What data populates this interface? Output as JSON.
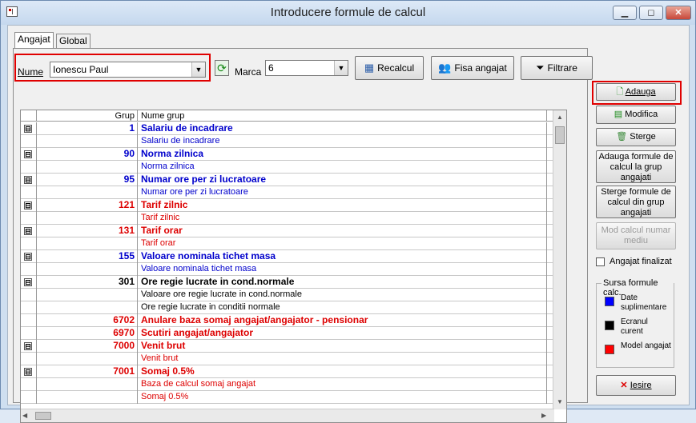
{
  "window": {
    "title": "Introducere formule de calcul",
    "minimize_label": "▭",
    "maximize_label": "◻",
    "close_label": "✕"
  },
  "tabs": [
    {
      "label": "Angajat"
    },
    {
      "label": "Global"
    }
  ],
  "filters": {
    "name_label": "Nume",
    "name_value": "Ionescu Paul",
    "marca_label": "Marca",
    "marca_value": "6"
  },
  "toolbar": {
    "recalcul": "Recalcul",
    "fisa": "Fisa angajat",
    "filtrare": "Filtrare"
  },
  "grid": {
    "headers": {
      "grup": "Grup",
      "nume": "Nume grup"
    },
    "rows": [
      {
        "toggle": "⊟",
        "grup": "1",
        "nume": "Salariu de incadrare",
        "type": "header",
        "color": "#0000cc"
      },
      {
        "toggle": "",
        "grup": "",
        "nume": "Salariu de incadrare",
        "type": "child",
        "color": "#0000cc"
      },
      {
        "toggle": "⊟",
        "grup": "90",
        "nume": "Norma zilnica",
        "type": "header",
        "color": "#0000cc"
      },
      {
        "toggle": "",
        "grup": "",
        "nume": "Norma zilnica",
        "type": "child",
        "color": "#0000cc"
      },
      {
        "toggle": "⊟",
        "grup": "95",
        "nume": "Numar ore per zi lucratoare",
        "type": "header",
        "color": "#0000cc"
      },
      {
        "toggle": "",
        "grup": "",
        "nume": "Numar ore per zi lucratoare",
        "type": "child",
        "color": "#0000cc"
      },
      {
        "toggle": "⊟",
        "grup": "121",
        "nume": "Tarif zilnic",
        "type": "header",
        "color": "#dd0000"
      },
      {
        "toggle": "",
        "grup": "",
        "nume": "Tarif zilnic",
        "type": "child",
        "color": "#dd0000"
      },
      {
        "toggle": "⊟",
        "grup": "131",
        "nume": "Tarif orar",
        "type": "header",
        "color": "#dd0000"
      },
      {
        "toggle": "",
        "grup": "",
        "nume": "Tarif orar",
        "type": "child",
        "color": "#dd0000"
      },
      {
        "toggle": "⊟",
        "grup": "155",
        "nume": "Valoare nominala tichet masa",
        "type": "header",
        "color": "#0000cc"
      },
      {
        "toggle": "",
        "grup": "",
        "nume": "Valoare nominala tichet masa",
        "type": "child",
        "color": "#0000cc"
      },
      {
        "toggle": "⊟",
        "grup": "301",
        "nume": "Ore regie lucrate in cond.normale",
        "type": "header",
        "color": "#000000"
      },
      {
        "toggle": "",
        "grup": "",
        "nume": "Valoare ore regie lucrate in cond.normale",
        "type": "child",
        "color": "#000000"
      },
      {
        "toggle": "",
        "grup": "",
        "nume": "Ore regie lucrate in conditii normale",
        "type": "child",
        "color": "#000000"
      },
      {
        "toggle": "",
        "grup": "6702",
        "nume": "Anulare baza somaj angajat/angajator - pensionar",
        "type": "header",
        "color": "#dd0000"
      },
      {
        "toggle": "",
        "grup": "6970",
        "nume": "Scutiri angajat/angajator",
        "type": "header",
        "color": "#dd0000"
      },
      {
        "toggle": "⊟",
        "grup": "7000",
        "nume": "Venit brut",
        "type": "header",
        "color": "#dd0000"
      },
      {
        "toggle": "",
        "grup": "",
        "nume": "Venit brut",
        "type": "child",
        "color": "#dd0000"
      },
      {
        "toggle": "⊟",
        "grup": "7001",
        "nume": "Somaj 0.5%",
        "type": "header",
        "color": "#dd0000"
      },
      {
        "toggle": "",
        "grup": "",
        "nume": "Baza de calcul somaj angajat",
        "type": "child",
        "color": "#dd0000"
      },
      {
        "toggle": "",
        "grup": "",
        "nume": "Somaj 0.5%",
        "type": "child",
        "color": "#dd0000"
      }
    ]
  },
  "actions": {
    "adauga": "Adauga",
    "modifica": "Modifica",
    "sterge": "Sterge",
    "adauga_grup": "Adauga formule de calcul la grup angajati",
    "sterge_grup": "Sterge formule de calcul din grup angajati",
    "mod_calcul": "Mod calcul numar mediu",
    "finalizat": "Angajat finalizat",
    "iesire": "Iesire"
  },
  "legend": {
    "title": "Sursa formule calc.",
    "items": [
      {
        "label": "Date suplimentare",
        "color": "#0000ff"
      },
      {
        "label": "Ecranul curent",
        "color": "#000000"
      },
      {
        "label": "Model angajat",
        "color": "#ff0000"
      }
    ]
  }
}
